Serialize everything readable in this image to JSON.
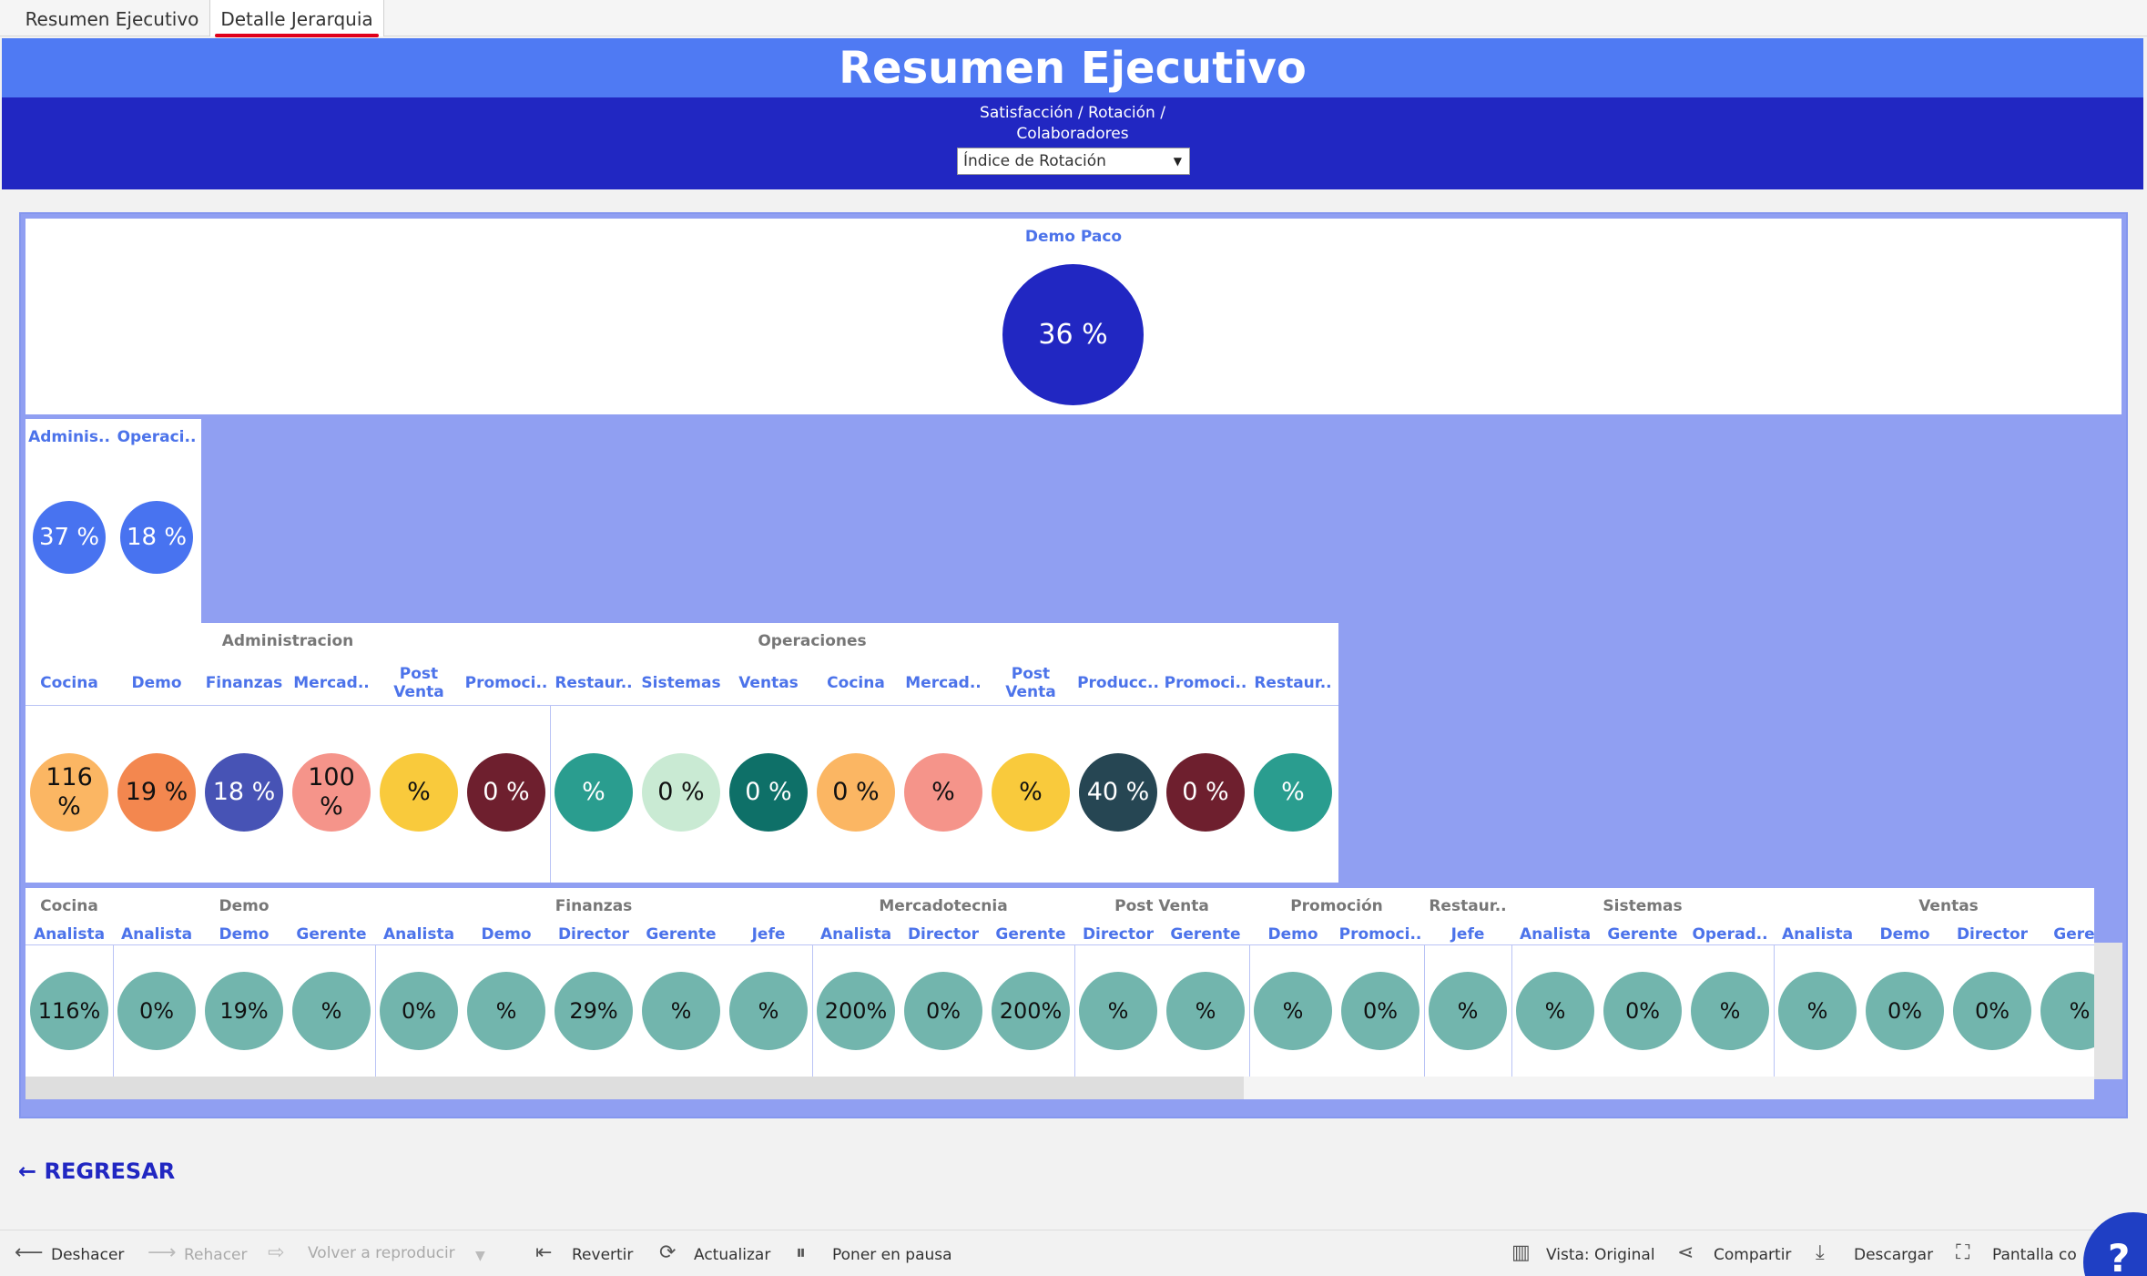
{
  "tabs": [
    {
      "label": "Resumen Ejecutivo"
    },
    {
      "label": "Detalle Jerarquia"
    }
  ],
  "header": {
    "title": "Resumen Ejecutivo",
    "subtitle_line1": "Satisfacción / Rotación /",
    "subtitle_line2": "Colaboradores",
    "dropdown_value": "Índice de Rotación"
  },
  "level0": {
    "name": "Demo Paco",
    "value": "36 %"
  },
  "level1": [
    {
      "name": "Adminis..",
      "value": "37 %"
    },
    {
      "name": "Operaci..",
      "value": "18 %"
    }
  ],
  "level2": {
    "groups": [
      "Administracion",
      "Operaciones"
    ],
    "items": [
      {
        "name": "Cocina",
        "value": "116 %"
      },
      {
        "name": "Demo",
        "value": "19 %"
      },
      {
        "name": "Finanzas",
        "value": "18 %"
      },
      {
        "name": "Mercad..",
        "value": "100 %"
      },
      {
        "name": "Post Venta",
        "value": "%"
      },
      {
        "name": "Promoci..",
        "value": "0 %"
      },
      {
        "name": "Restaur..",
        "value": "%"
      },
      {
        "name": "Sistemas",
        "value": "0 %"
      },
      {
        "name": "Ventas",
        "value": "0 %"
      },
      {
        "name": "Cocina",
        "value": "0 %"
      },
      {
        "name": "Mercad..",
        "value": "%"
      },
      {
        "name": "Post Venta",
        "value": "%"
      },
      {
        "name": "Producc..",
        "value": "40 %"
      },
      {
        "name": "Promoci..",
        "value": "0 %"
      },
      {
        "name": "Restaur..",
        "value": "%"
      }
    ]
  },
  "level3": {
    "groups": [
      "Cocina",
      "Demo",
      "Finanzas",
      "Mercadotecnia",
      "Post Venta",
      "Promoción",
      "Restaur..",
      "Sistemas",
      "Ventas"
    ],
    "items": [
      {
        "name": "Analista",
        "value": "116%"
      },
      {
        "name": "Analista",
        "value": "0%"
      },
      {
        "name": "Demo",
        "value": "19%"
      },
      {
        "name": "Gerente",
        "value": "%"
      },
      {
        "name": "Analista",
        "value": "0%"
      },
      {
        "name": "Demo",
        "value": "%"
      },
      {
        "name": "Director",
        "value": "29%"
      },
      {
        "name": "Gerente",
        "value": "%"
      },
      {
        "name": "Jefe",
        "value": "%"
      },
      {
        "name": "Analista",
        "value": "200%"
      },
      {
        "name": "Director",
        "value": "0%"
      },
      {
        "name": "Gerente",
        "value": "200%"
      },
      {
        "name": "Director",
        "value": "%"
      },
      {
        "name": "Gerente",
        "value": "%"
      },
      {
        "name": "Demo",
        "value": "%"
      },
      {
        "name": "Promoci..",
        "value": "0%"
      },
      {
        "name": "Jefe",
        "value": "%"
      },
      {
        "name": "Analista",
        "value": "%"
      },
      {
        "name": "Gerente",
        "value": "0%"
      },
      {
        "name": "Operad..",
        "value": "%"
      },
      {
        "name": "Analista",
        "value": "%"
      },
      {
        "name": "Demo",
        "value": "0%"
      },
      {
        "name": "Director",
        "value": "0%"
      },
      {
        "name": "Geren",
        "value": "%"
      }
    ]
  },
  "back_link": "← REGRESAR",
  "toolbar": {
    "undo": "Deshacer",
    "redo": "Rehacer",
    "replay": "Volver a reproducir",
    "revert": "Revertir",
    "refresh": "Actualizar",
    "pause": "Poner en pausa",
    "view": "Vista: Original",
    "share": "Compartir",
    "download": "Descargar",
    "fullscreen": "Pantalla co",
    "help": "?"
  },
  "colors": {
    "header_light": "#4f7af3",
    "header_dark": "#2127c2",
    "frame": "#909ff2",
    "label_blue": "#4c73ea",
    "level0_circle": "#2127c2",
    "level1_circle": "#4873f0",
    "level3_circle": "#72b5ad",
    "level2_circles": [
      "#fbb663",
      "#f3874f",
      "#4753b5",
      "#f5948a",
      "#f9ca3c",
      "#6e1f2e",
      "#2a9d8f",
      "#c9ead3",
      "#0e7068",
      "#fbb663",
      "#f5948a",
      "#f9ca3c",
      "#264653",
      "#6e1f2e",
      "#2a9d8f"
    ],
    "level2_text": [
      "#111",
      "#111",
      "#fff",
      "#111",
      "#111",
      "#fff",
      "#fff",
      "#111",
      "#fff",
      "#111",
      "#111",
      "#111",
      "#fff",
      "#fff",
      "#fff"
    ]
  }
}
